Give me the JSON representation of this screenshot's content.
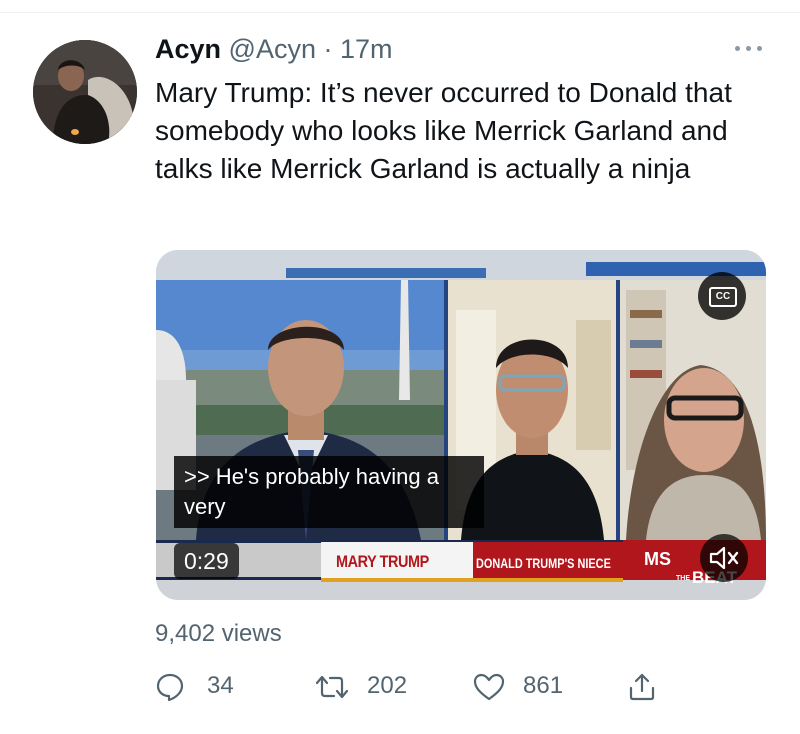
{
  "tweet": {
    "author_name": "Acyn",
    "author_handle": "@Acyn",
    "separator": "·",
    "timestamp": "17m",
    "text": "Mary Trump: It’s never occurred to Donald that somebody who looks like Merrick Garland and talks like Merrick Garland is actually a ninja"
  },
  "media": {
    "cc_label": "CC",
    "caption": ">> He's probably having a very",
    "duration": "0:29",
    "lower_third_name": "MARY TRUMP",
    "lower_third_description": "DONALD TRUMP'S NIECE",
    "network_logo": "MS",
    "show_prefix": "THE",
    "show_name": "BEAT"
  },
  "stats": {
    "views": "9,402 views",
    "replies": "34",
    "retweets": "202",
    "likes": "861"
  },
  "icons": {
    "more": "more-horizontal-icon",
    "reply": "speech-bubble-icon",
    "retweet": "retweet-arrows-icon",
    "like": "heart-icon",
    "share": "share-upload-icon",
    "cc": "closed-captions-icon",
    "mute": "speaker-muted-icon"
  },
  "colors": {
    "text_primary": "#0f1419",
    "text_secondary": "#536471",
    "msnbc_red": "#b0161b"
  }
}
